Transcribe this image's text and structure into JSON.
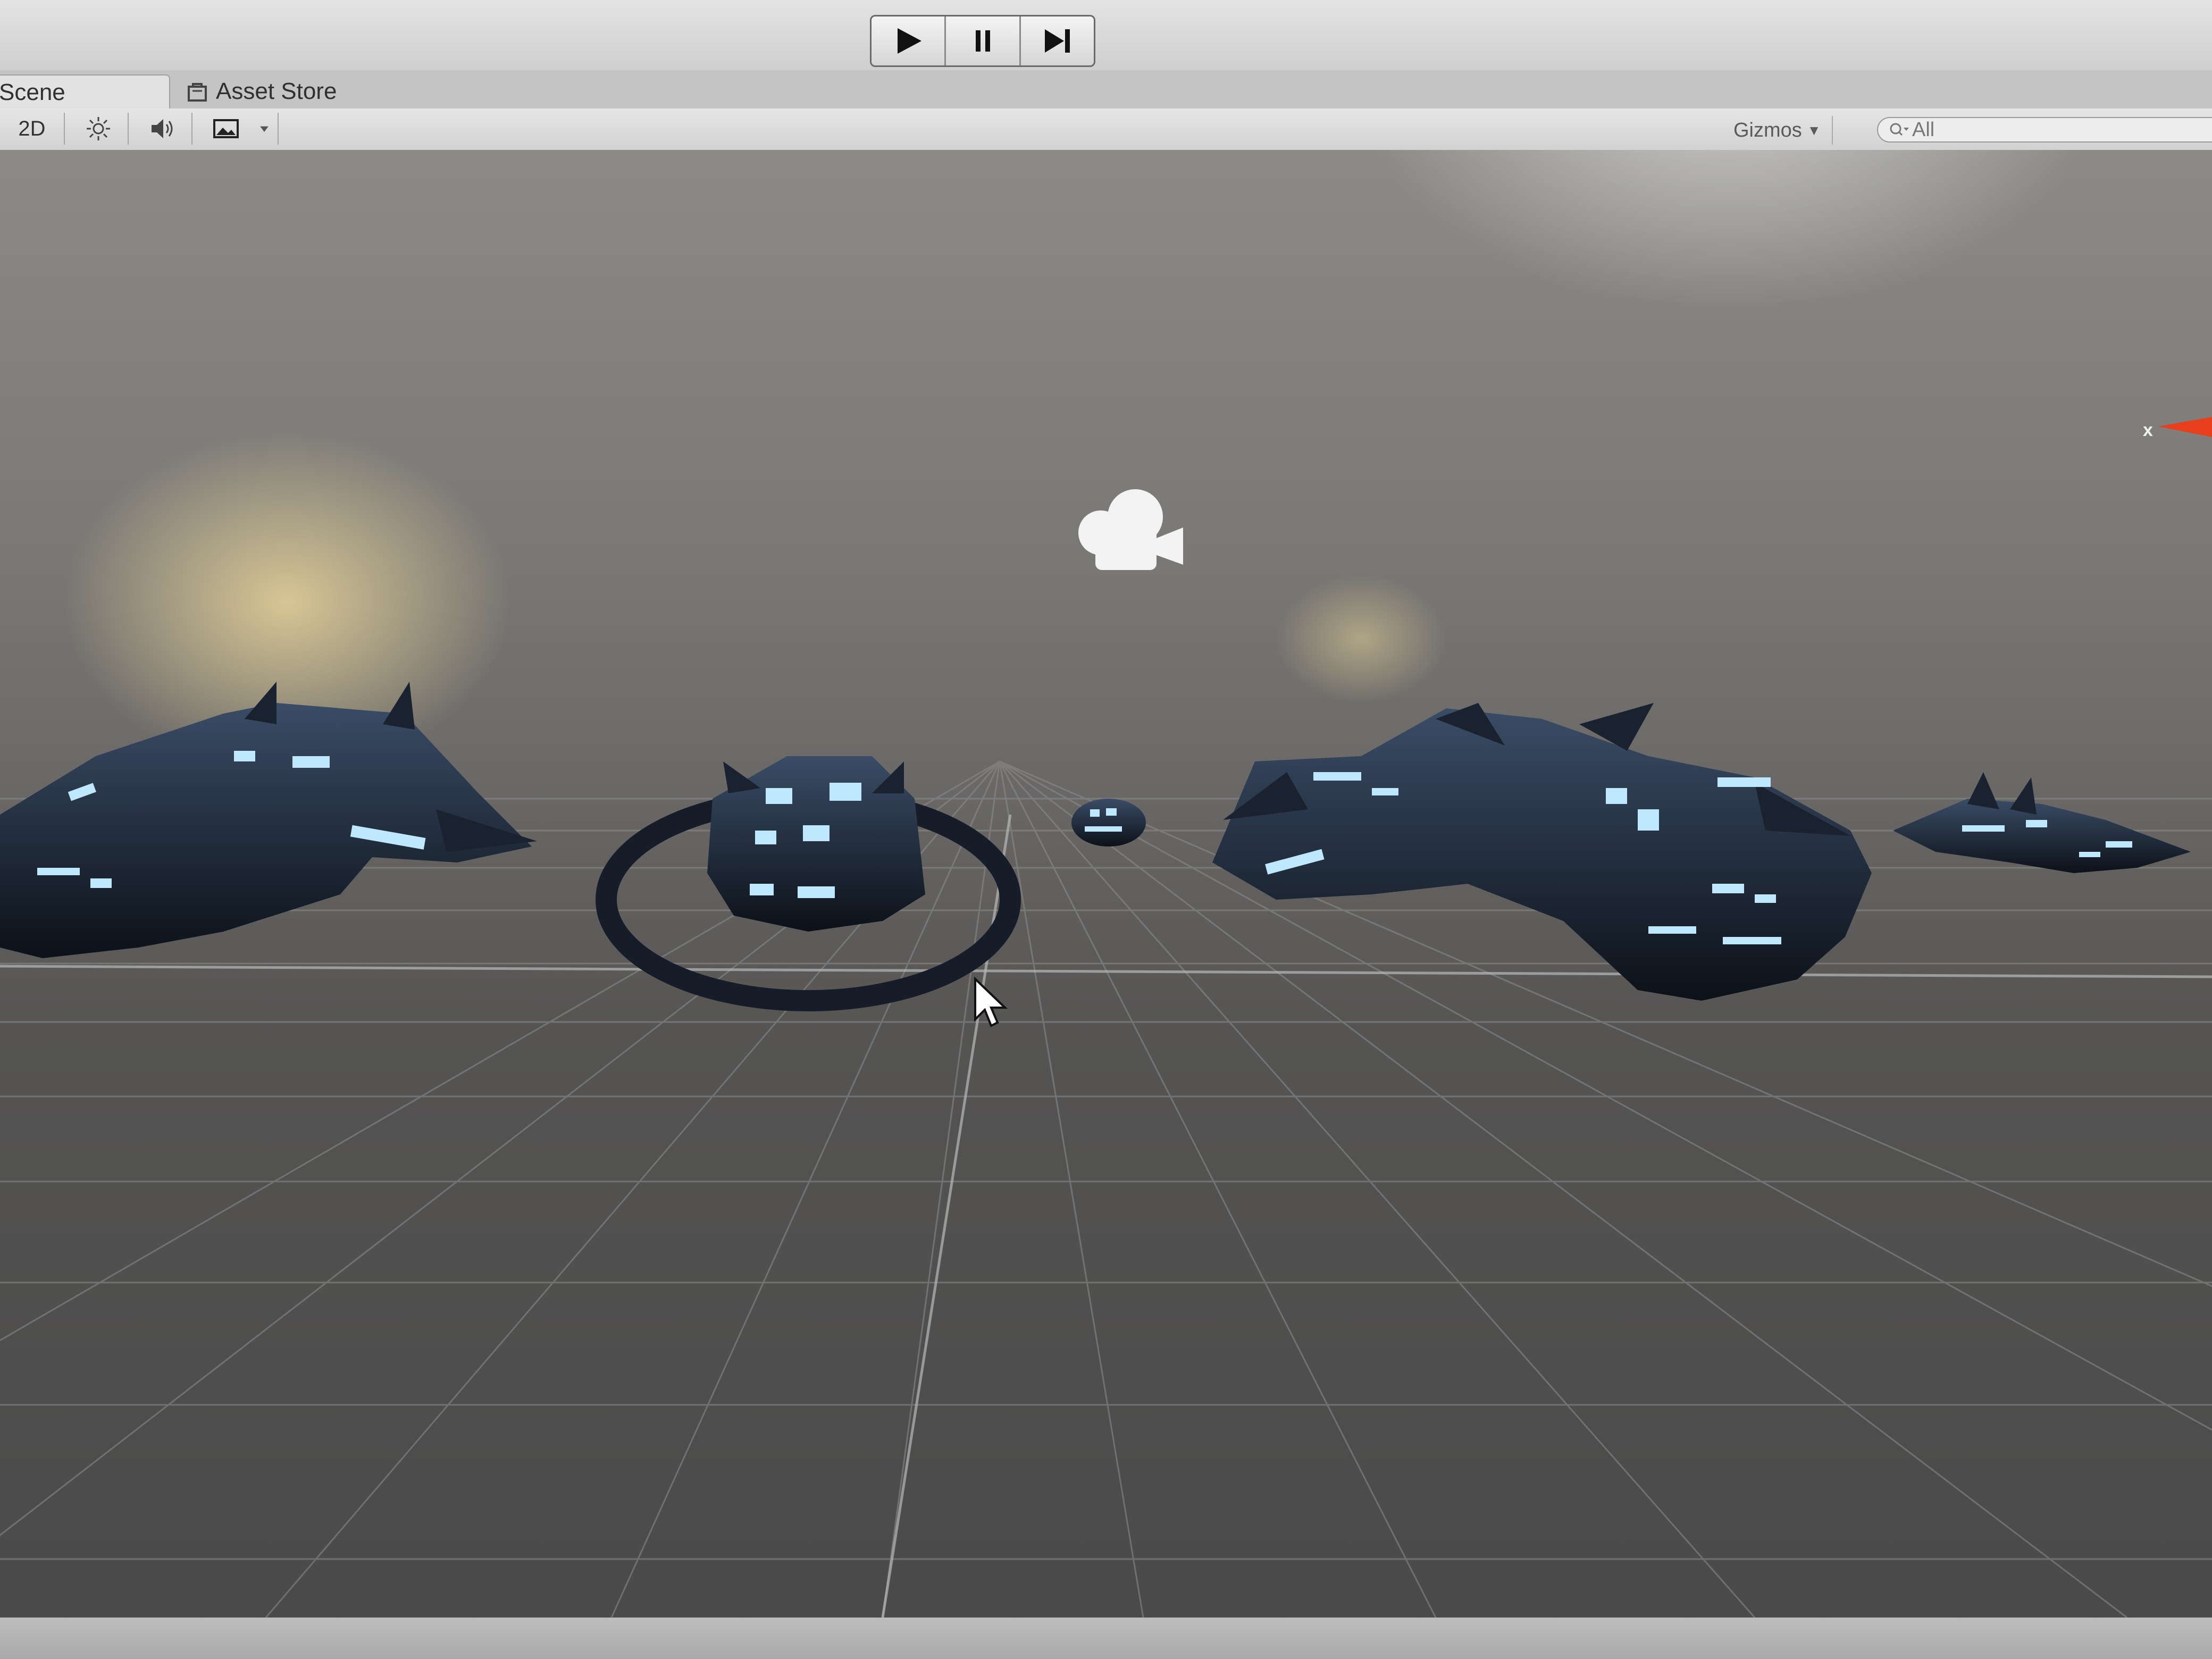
{
  "toolbar": {
    "play": "play-icon",
    "pause": "pause-icon",
    "step": "step-icon"
  },
  "tabs": {
    "scene": "Scene",
    "asset_store": "Asset Store"
  },
  "scene_toolbar": {
    "mode_2d": "2D",
    "lighting_icon": "sun-icon",
    "audio_icon": "speaker-icon",
    "effects_icon": "image-icon",
    "gizmos": "Gizmos",
    "search_value": "All"
  },
  "scene": {
    "camera_icon": "camera-gizmo-icon",
    "objects": [
      "spaceship-1",
      "spaceship-2",
      "spaceship-3",
      "spaceship-4",
      "spaceship-5"
    ]
  },
  "colors": {
    "accent_axis_x": "#e8401c",
    "ship_hull": "#1a2230",
    "ship_light": "#bfe8ff"
  }
}
